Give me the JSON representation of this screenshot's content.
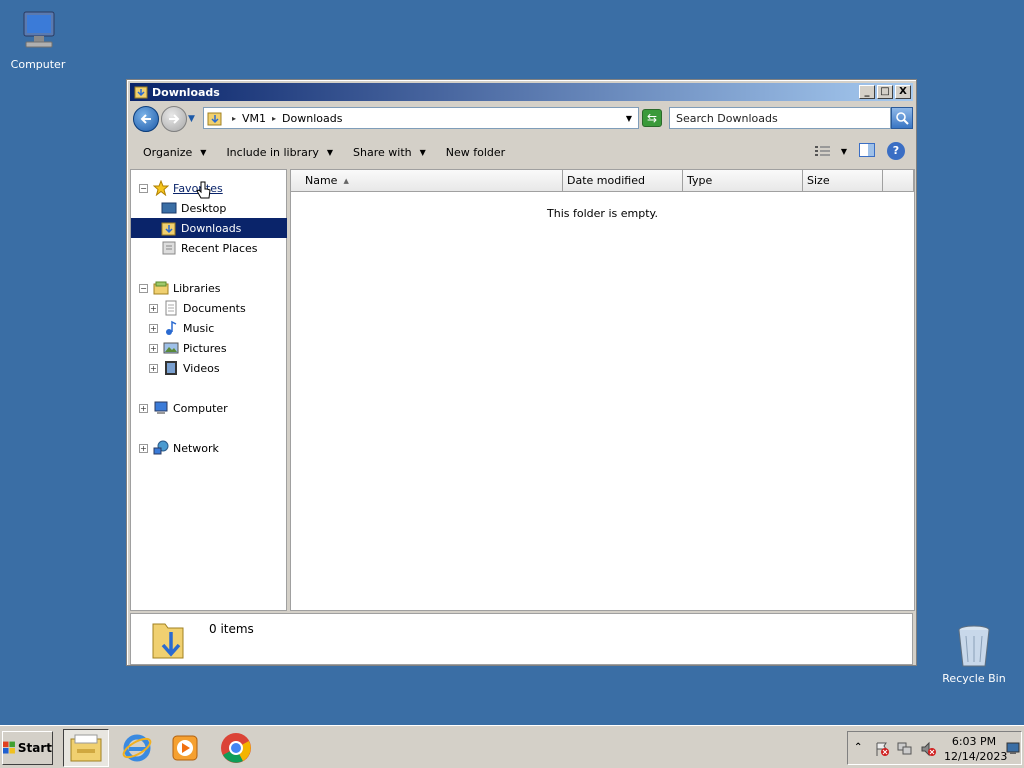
{
  "desktop": {
    "computer_label": "Computer",
    "recycle_label": "Recycle Bin"
  },
  "window": {
    "title": "Downloads",
    "buttons": {
      "minimize": "_",
      "maximize": "□",
      "close": "X"
    }
  },
  "address": {
    "crumbs": [
      "VM1",
      "Downloads"
    ],
    "separator": "▸"
  },
  "search": {
    "placeholder": "Search Downloads"
  },
  "command_bar": {
    "organize": "Organize",
    "include_in_library": "Include in library",
    "share_with": "Share with",
    "new_folder": "New folder",
    "help": "?"
  },
  "nav": {
    "favorites": "Favorites",
    "desktop": "Desktop",
    "downloads": "Downloads",
    "recent_places": "Recent Places",
    "libraries": "Libraries",
    "documents": "Documents",
    "music": "Music",
    "pictures": "Pictures",
    "videos": "Videos",
    "computer": "Computer",
    "network": "Network"
  },
  "columns": {
    "name": "Name",
    "date_modified": "Date modified",
    "type": "Type",
    "size": "Size"
  },
  "content": {
    "empty_message": "This folder is empty."
  },
  "details": {
    "item_count": "0 items"
  },
  "taskbar": {
    "start_label": "Start",
    "time": "6:03 PM",
    "date": "12/14/2023"
  },
  "colors": {
    "desktop_bg": "#3a6ea5",
    "selection": "#0a246a",
    "title_gradient_start": "#0a246a",
    "title_gradient_end": "#a6caf0"
  }
}
